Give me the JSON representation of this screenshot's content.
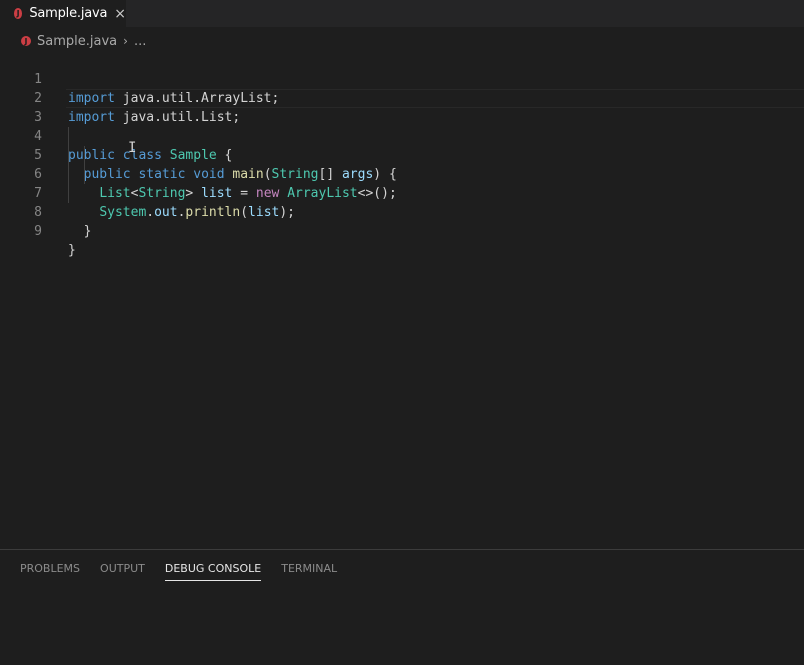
{
  "tab": {
    "label": "Sample.java",
    "icon": "java-file-icon",
    "close": "×"
  },
  "breadcrumb": {
    "file": "Sample.java",
    "separator": "›",
    "more": "..."
  },
  "line_numbers": [
    "1",
    "2",
    "3",
    "4",
    "5",
    "6",
    "7",
    "8",
    "9"
  ],
  "code_lines": [
    "import java.util.ArrayList;",
    "import java.util.List;",
    "",
    "public class Sample {",
    "  public static void main(String[] args) {",
    "    List<String> list = new ArrayList<>();",
    "    System.out.println(list);",
    "  }",
    "}"
  ],
  "panel": {
    "tabs": [
      "PROBLEMS",
      "OUTPUT",
      "DEBUG CONSOLE",
      "TERMINAL"
    ],
    "active": "DEBUG CONSOLE"
  },
  "colors": {
    "background": "#1e1e1e",
    "keyword": "#569cd6",
    "type": "#4ec9b0",
    "function": "#dcdcaa",
    "variable": "#9cdcfe",
    "new_keyword": "#c586c0"
  }
}
